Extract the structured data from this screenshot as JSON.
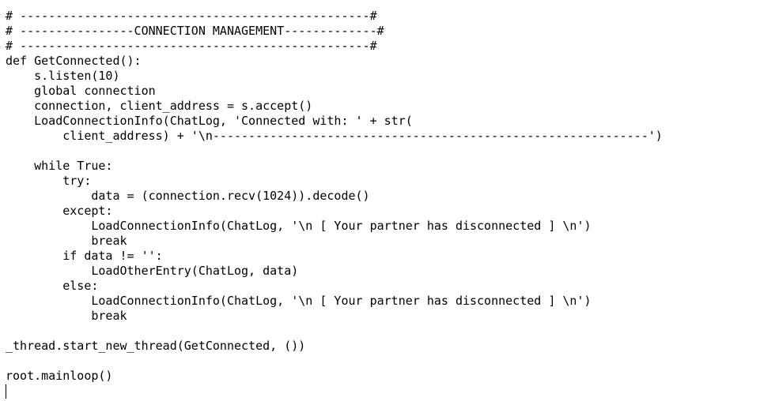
{
  "editor": {
    "lines": [
      "# -------------------------------------------------#",
      "# ----------------CONNECTION MANAGEMENT-------------#",
      "# -------------------------------------------------#",
      "def GetConnected():",
      "    s.listen(10)",
      "    global connection",
      "    connection, client_address = s.accept()",
      "    LoadConnectionInfo(ChatLog, 'Connected with: ' + str(",
      "        client_address) + '\\n-------------------------------------------------------------')",
      "",
      "    while True:",
      "        try:",
      "            data = (connection.recv(1024)).decode()",
      "        except:",
      "            LoadConnectionInfo(ChatLog, '\\n [ Your partner has disconnected ] \\n')",
      "            break",
      "        if data != '':",
      "            LoadOtherEntry(ChatLog, data)",
      "        else:",
      "            LoadConnectionInfo(ChatLog, '\\n [ Your partner has disconnected ] \\n')",
      "            break",
      "",
      "_thread.start_new_thread(GetConnected, ())",
      "",
      "root.mainloop()"
    ]
  }
}
